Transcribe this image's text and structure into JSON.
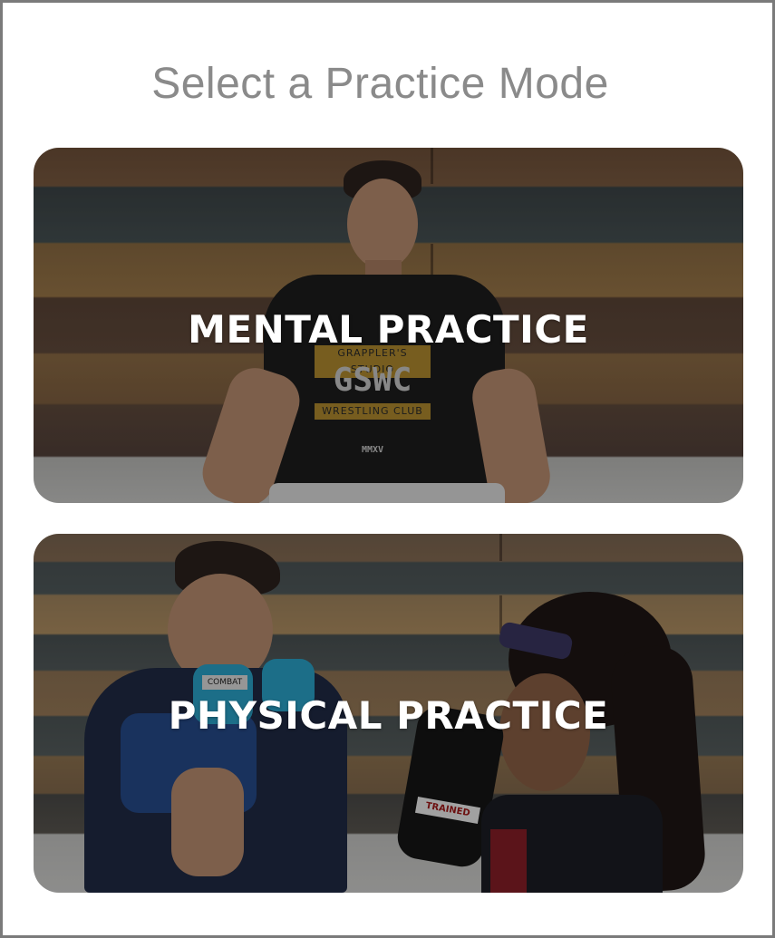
{
  "page": {
    "title": "Select a Practice Mode"
  },
  "modes": [
    {
      "id": "mental",
      "label": "MENTAL PRACTICE"
    },
    {
      "id": "physical",
      "label": "PHYSICAL PRACTICE"
    }
  ],
  "photo_details": {
    "shirt_top_band": "GRAPPLER'S STUDIO",
    "shirt_logo": "GSWC",
    "shirt_bottom_band": "WRESTLING CLUB",
    "shirt_footer": "MMXV",
    "glove_text_left": "COMBAT",
    "glove_text_right": "TRAINED"
  },
  "colors": {
    "title": "#8a8a8a",
    "label": "#ffffff",
    "frame_border": "#7a7a7a"
  }
}
